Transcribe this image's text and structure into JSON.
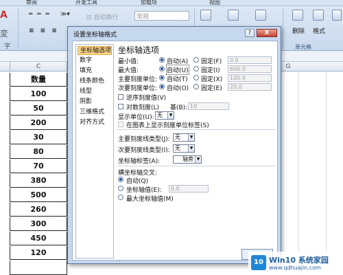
{
  "ribbon": {
    "tabs": [
      "",
      "审阅",
      "开发工具",
      "",
      "加载项",
      "",
      "视图",
      "",
      ""
    ],
    "autowrap": "自动换行",
    "format_select": "常规",
    "delete_label": "删除",
    "format_label": "格式",
    "cells_group": "单元格",
    "group_marker": "字"
  },
  "sheet": {
    "col_c": "C",
    "col_g": "G",
    "header": "数量",
    "values": [
      "100",
      "50",
      "200",
      "30",
      "80",
      "70",
      "380",
      "500",
      "260",
      "300",
      "450",
      "120"
    ]
  },
  "dialog": {
    "title": "设置坐标轴格式",
    "help": "?",
    "close": "X",
    "nav": [
      "坐标轴选项",
      "数字",
      "填充",
      "线条颜色",
      "线型",
      "阴影",
      "三维格式",
      "对齐方式"
    ],
    "section_title": "坐标轴选项",
    "rows": [
      {
        "label": "最小值:",
        "auto": "自动(A)",
        "fixed": "固定(F)",
        "value": "0.0"
      },
      {
        "label": "最大值:",
        "auto": "自动(U)",
        "fixed": "固定(I)",
        "value": "600.0"
      },
      {
        "label": "主要刻度单位:",
        "auto": "自动(T)",
        "fixed": "固定(X)",
        "value": "100.0"
      },
      {
        "label": "次要刻度单位:",
        "auto": "自动(O)",
        "fixed": "固定(E)",
        "value": "20.0"
      }
    ],
    "reverse_label": "逆序刻度值(V)",
    "log_label": "对数刻度(L)",
    "log_base_label": "基(B):",
    "log_base_value": "10",
    "display_units_label": "显示单位(U):",
    "display_units_value": "无",
    "show_units_label": "在图表上显示刻度单位标签(S)",
    "major_tick_label": "主要刻度线类型(J):",
    "major_tick_value": "无",
    "minor_tick_label": "次要刻度线类型(I):",
    "minor_tick_value": "无",
    "axis_labels_label": "坐标轴标签(A):",
    "axis_labels_value": "轴旁",
    "cross_label": "横坐标轴交叉:",
    "cross_auto": "自动(Q)",
    "cross_value_label": "坐标轴值(E):",
    "cross_value": "0.0",
    "cross_max": "最大坐标轴值(M)"
  },
  "watermark": {
    "logo": "10",
    "text": "Win10 系统家园",
    "url": "www.qdhuajin.com"
  }
}
